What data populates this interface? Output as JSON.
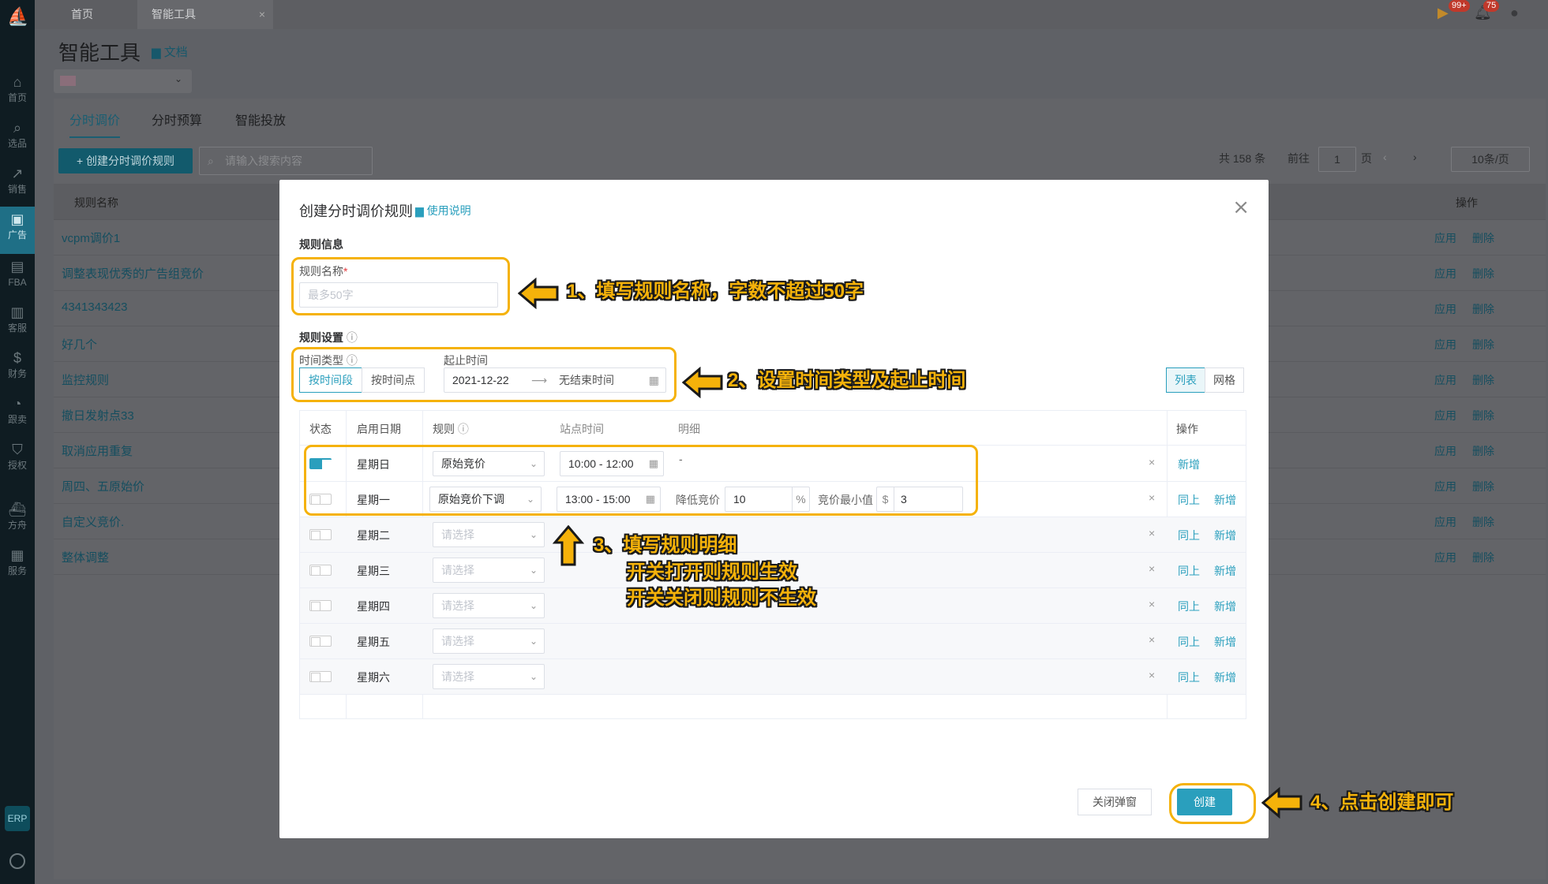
{
  "sidebar": {
    "items": [
      {
        "label": "首页",
        "icon": "home-icon"
      },
      {
        "label": "选品",
        "icon": "search-icon"
      },
      {
        "label": "销售",
        "icon": "trend-icon"
      },
      {
        "label": "广告",
        "icon": "ad-icon"
      },
      {
        "label": "FBA",
        "icon": "box-icon"
      },
      {
        "label": "客服",
        "icon": "chart-icon"
      },
      {
        "label": "财务",
        "icon": "dollar-icon"
      },
      {
        "label": "跟卖",
        "icon": "pie-icon"
      },
      {
        "label": "授权",
        "icon": "shield-icon"
      },
      {
        "label": "方舟",
        "icon": "ship-icon"
      },
      {
        "label": "服务",
        "icon": "store-icon"
      }
    ],
    "erp": "ERP"
  },
  "tabs": {
    "home": "首页",
    "current": "智能工具"
  },
  "topbar": {
    "badge1": "99+",
    "badge2": "75"
  },
  "page": {
    "title": "智能工具",
    "doc": "文档"
  },
  "main": {
    "tabs": [
      "分时调价",
      "分时预算",
      "智能投放"
    ],
    "create_btn": "+ 创建分时调价规则",
    "search_placeholder": "请输入搜索内容",
    "total": "共 158 条",
    "goto": "前往",
    "page": "1",
    "page_unit": "页",
    "page_size": "10条/页"
  },
  "table": {
    "col_name": "规则名称",
    "col_op": "操作",
    "apply": "应用",
    "delete": "删除",
    "rows": [
      "vcpm调价1",
      "调整表现优秀的广告组竞价",
      "4341343423",
      "好几个",
      "监控规则",
      "撤日发射点33",
      "取消应用重复",
      "周四、五原始价",
      "自定义竞价.",
      "整体调整"
    ]
  },
  "modal": {
    "title": "创建分时调价规则",
    "help": "使用说明",
    "section_info": "规则信息",
    "name_label": "规则名称",
    "name_placeholder": "最多50字",
    "section_settings": "规则设置",
    "time_type_label": "时间类型",
    "period_label": "起止时间",
    "seg_range": "按时间段",
    "seg_point": "按时间点",
    "start_date": "2021-12-22",
    "end_date": "无结束时间",
    "view_list": "列表",
    "view_grid": "网格",
    "grid": {
      "h_status": "状态",
      "h_date": "启用日期",
      "h_rule": "规则",
      "h_time": "站点时间",
      "h_detail": "明细",
      "h_op": "操作",
      "days": [
        "星期日",
        "星期一",
        "星期二",
        "星期三",
        "星期四",
        "星期五",
        "星期六"
      ],
      "rule0": "原始竞价",
      "rule1": "原始竞价下调",
      "rule_placeholder": "请选择",
      "time0": "10:00 - 12:00",
      "time1": "13:00 - 15:00",
      "dash": "-",
      "lower_label": "降低竞价",
      "lower_value": "10",
      "pct": "%",
      "min_label": "竞价最小值",
      "dollar": "$",
      "min_value": "3",
      "same": "同上",
      "add": "新增",
      "x": "×"
    },
    "btn_close": "关闭弹窗",
    "btn_create": "创建"
  },
  "annotations": {
    "n1": "1、填写规则名称，字数不超过50字",
    "n2": "2、设置时间类型及起止时间",
    "n3a": "3、填写规则明细",
    "n3b": "开关打开则规则生效",
    "n3c": "开关关闭则规则不生效",
    "n4": "4、点击创建即可"
  },
  "colors": {
    "accent": "#2a9fbd",
    "highlight": "#f5b20a",
    "sidebar": "#0f1c22"
  }
}
